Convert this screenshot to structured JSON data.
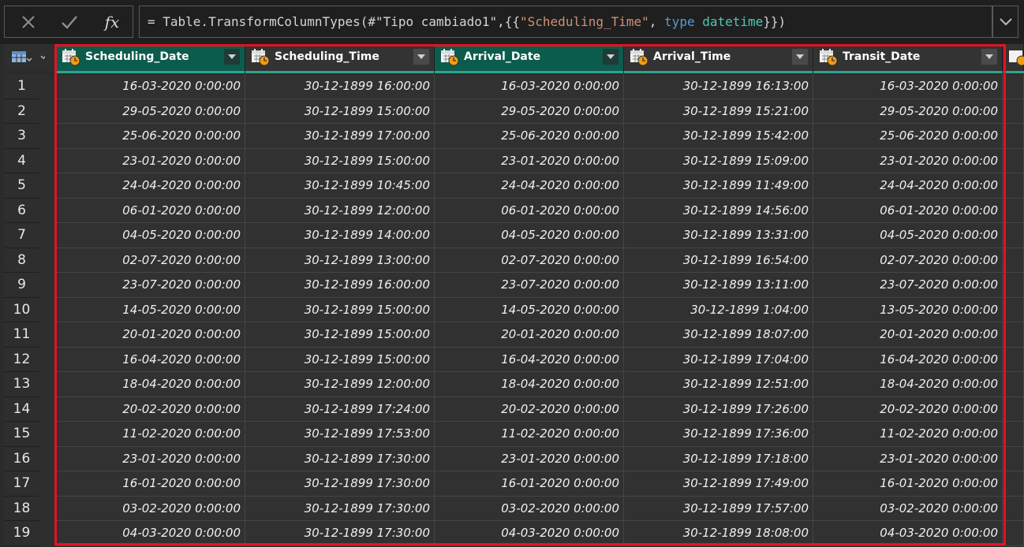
{
  "formula_bar": {
    "cancel_icon": "x-icon",
    "commit_icon": "check-icon",
    "fx_label": "fx",
    "formula_prefix": "= Table.TransformColumnTypes(#\"Tipo cambiado1\",{{",
    "formula_string": "\"Scheduling_Time\"",
    "formula_sep": ", ",
    "formula_keyword": "type",
    "formula_space": " ",
    "formula_type": "datetime",
    "formula_suffix": "}})"
  },
  "colors": {
    "selected_header": "#0c5c4e",
    "header": "#333333",
    "accent_bar": "#31a48e",
    "selection_border": "#e81123"
  },
  "columns": [
    {
      "label": "Scheduling_Date",
      "selected": true,
      "icon": "datetime-type-icon"
    },
    {
      "label": "Scheduling_Time",
      "selected": false,
      "icon": "datetime-type-icon"
    },
    {
      "label": "Arrival_Date",
      "selected": true,
      "icon": "datetime-type-icon"
    },
    {
      "label": "Arrival_Time",
      "selected": false,
      "icon": "datetime-type-icon"
    },
    {
      "label": "Transit_Date",
      "selected": false,
      "icon": "datetime-type-icon"
    }
  ],
  "rows": [
    {
      "n": "1",
      "c": [
        "16-03-2020 0:00:00",
        "30-12-1899 16:00:00",
        "16-03-2020 0:00:00",
        "30-12-1899 16:13:00",
        "16-03-2020 0:00:00"
      ]
    },
    {
      "n": "2",
      "c": [
        "29-05-2020 0:00:00",
        "30-12-1899 15:00:00",
        "29-05-2020 0:00:00",
        "30-12-1899 15:21:00",
        "29-05-2020 0:00:00"
      ]
    },
    {
      "n": "3",
      "c": [
        "25-06-2020 0:00:00",
        "30-12-1899 17:00:00",
        "25-06-2020 0:00:00",
        "30-12-1899 15:42:00",
        "25-06-2020 0:00:00"
      ]
    },
    {
      "n": "4",
      "c": [
        "23-01-2020 0:00:00",
        "30-12-1899 15:00:00",
        "23-01-2020 0:00:00",
        "30-12-1899 15:09:00",
        "23-01-2020 0:00:00"
      ]
    },
    {
      "n": "5",
      "c": [
        "24-04-2020 0:00:00",
        "30-12-1899 10:45:00",
        "24-04-2020 0:00:00",
        "30-12-1899 11:49:00",
        "24-04-2020 0:00:00"
      ]
    },
    {
      "n": "6",
      "c": [
        "06-01-2020 0:00:00",
        "30-12-1899 12:00:00",
        "06-01-2020 0:00:00",
        "30-12-1899 14:56:00",
        "06-01-2020 0:00:00"
      ]
    },
    {
      "n": "7",
      "c": [
        "04-05-2020 0:00:00",
        "30-12-1899 14:00:00",
        "04-05-2020 0:00:00",
        "30-12-1899 13:31:00",
        "04-05-2020 0:00:00"
      ]
    },
    {
      "n": "8",
      "c": [
        "02-07-2020 0:00:00",
        "30-12-1899 13:00:00",
        "02-07-2020 0:00:00",
        "30-12-1899 16:54:00",
        "02-07-2020 0:00:00"
      ]
    },
    {
      "n": "9",
      "c": [
        "23-07-2020 0:00:00",
        "30-12-1899 16:00:00",
        "23-07-2020 0:00:00",
        "30-12-1899 13:11:00",
        "23-07-2020 0:00:00"
      ]
    },
    {
      "n": "10",
      "c": [
        "14-05-2020 0:00:00",
        "30-12-1899 15:00:00",
        "14-05-2020 0:00:00",
        "30-12-1899 1:04:00",
        "13-05-2020 0:00:00"
      ]
    },
    {
      "n": "11",
      "c": [
        "20-01-2020 0:00:00",
        "30-12-1899 15:00:00",
        "20-01-2020 0:00:00",
        "30-12-1899 18:07:00",
        "20-01-2020 0:00:00"
      ]
    },
    {
      "n": "12",
      "c": [
        "16-04-2020 0:00:00",
        "30-12-1899 15:00:00",
        "16-04-2020 0:00:00",
        "30-12-1899 17:04:00",
        "16-04-2020 0:00:00"
      ]
    },
    {
      "n": "13",
      "c": [
        "18-04-2020 0:00:00",
        "30-12-1899 12:00:00",
        "18-04-2020 0:00:00",
        "30-12-1899 12:51:00",
        "18-04-2020 0:00:00"
      ]
    },
    {
      "n": "14",
      "c": [
        "20-02-2020 0:00:00",
        "30-12-1899 17:24:00",
        "20-02-2020 0:00:00",
        "30-12-1899 17:26:00",
        "20-02-2020 0:00:00"
      ]
    },
    {
      "n": "15",
      "c": [
        "11-02-2020 0:00:00",
        "30-12-1899 17:53:00",
        "11-02-2020 0:00:00",
        "30-12-1899 17:36:00",
        "11-02-2020 0:00:00"
      ]
    },
    {
      "n": "16",
      "c": [
        "23-01-2020 0:00:00",
        "30-12-1899 17:30:00",
        "23-01-2020 0:00:00",
        "30-12-1899 17:18:00",
        "23-01-2020 0:00:00"
      ]
    },
    {
      "n": "17",
      "c": [
        "16-01-2020 0:00:00",
        "30-12-1899 17:30:00",
        "16-01-2020 0:00:00",
        "30-12-1899 17:49:00",
        "16-01-2020 0:00:00"
      ]
    },
    {
      "n": "18",
      "c": [
        "03-02-2020 0:00:00",
        "30-12-1899 17:30:00",
        "03-02-2020 0:00:00",
        "30-12-1899 17:57:00",
        "03-02-2020 0:00:00"
      ]
    },
    {
      "n": "19",
      "c": [
        "04-03-2020 0:00:00",
        "30-12-1899 17:30:00",
        "04-03-2020 0:00:00",
        "30-12-1899 18:08:00",
        "04-03-2020 0:00:00"
      ]
    }
  ]
}
